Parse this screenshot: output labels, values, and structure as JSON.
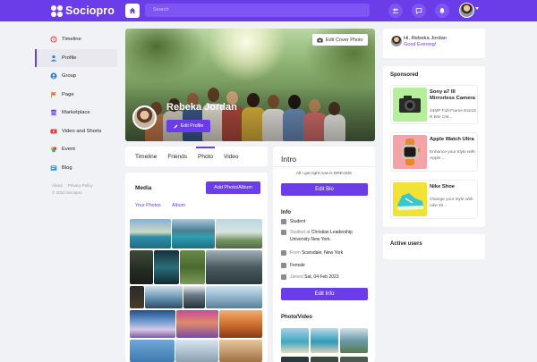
{
  "app": {
    "name": "Sociopro"
  },
  "topbar": {
    "search_placeholder": "Search"
  },
  "sidebar": {
    "items": [
      {
        "label": "Timeline",
        "icon": "clock-icon",
        "color": "#e0433a"
      },
      {
        "label": "Profile",
        "icon": "user-icon",
        "color": "#2a7de1"
      },
      {
        "label": "Group",
        "icon": "group-icon",
        "color": "#2a7de1"
      },
      {
        "label": "Page",
        "icon": "flag-icon",
        "color": "#f07a2a"
      },
      {
        "label": "Marketplace",
        "icon": "store-icon",
        "color": "#6a3de8"
      },
      {
        "label": "Video and Shorts",
        "icon": "video-icon",
        "color": "#e0433a"
      },
      {
        "label": "Event",
        "icon": "event-icon",
        "color": "#f0a32a"
      },
      {
        "label": "Blog",
        "icon": "blog-icon",
        "color": "#2a9de1"
      }
    ],
    "footer": {
      "about": "About",
      "privacy": "Privacy Policy",
      "copyright": "© 2023 Sociopro"
    }
  },
  "profile": {
    "name": "Rebeka Jordan",
    "edit_cover_label": "Edit Cover Photo",
    "edit_profile_label": "Edit Profile"
  },
  "tabs": [
    "Timeline",
    "Friends",
    "Photo",
    "Video"
  ],
  "media": {
    "title": "Media",
    "add_label": "Add Photo/Album",
    "tab_photos": "Your Photos",
    "tab_album": "Album"
  },
  "intro": {
    "title": "Intro",
    "bio": "All I got right now is DREAMS",
    "edit_bio_label": "Edit Bio",
    "info_title": "Info",
    "role": "Student",
    "studied_prefix": "Studied at",
    "studied_at": "Christian Leadership University New York.",
    "from_prefix": "From",
    "from": "Scarsdale, New York",
    "gender": "Female",
    "joined_prefix": "Joined",
    "joined": "Sat, 04 Feb 2023",
    "edit_info_label": "Edit Info",
    "photo_video_title": "Photo/Video"
  },
  "greeting": {
    "name": "Hi, Rebeka Jordan",
    "sub": "Good Evening!"
  },
  "sponsored": {
    "title": "Sponsored",
    "items": [
      {
        "name": "Sony a7 III Mirrorless Camera",
        "desc": "24MP Full-Frame Exmor R BSI CM..."
      },
      {
        "name": "Apple Watch Ultra",
        "desc": "Enhance your style with Apple ..."
      },
      {
        "name": "Nike Shoe",
        "desc": "Change your style with nike sh..."
      }
    ]
  },
  "active_users": {
    "title": "Active users"
  },
  "colors": {
    "accent": "#6a3de8",
    "background": "#f1f2f6"
  }
}
